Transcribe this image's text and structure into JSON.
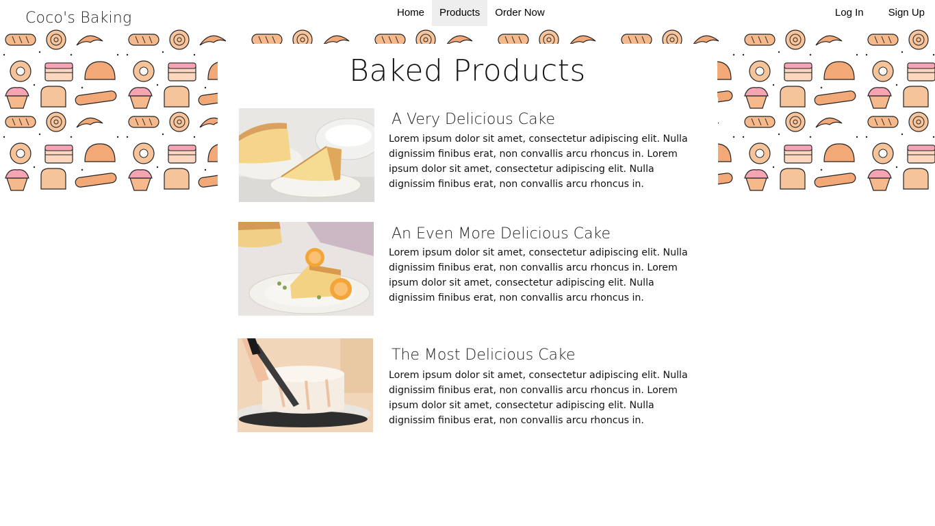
{
  "brand": {
    "name": "Coco's Baking"
  },
  "nav": {
    "links": [
      {
        "label": "Home"
      },
      {
        "label": "Products"
      },
      {
        "label": "Order Now"
      }
    ],
    "active": "Products",
    "auth": [
      {
        "label": "Log In"
      },
      {
        "label": "Sign Up"
      }
    ]
  },
  "page": {
    "title": "Baked Products"
  },
  "products": [
    {
      "title": "A Very Delicious Cake",
      "description": "Lorem ipsum dolor sit amet, consectetur adipiscing elit. Nulla dignissim finibus erat, non convallis arcu rhoncus in. Lorem ipsum dolor sit amet, consectetur adipiscing elit. Nulla dignissim finibus erat, non convallis arcu rhoncus in.",
      "image": "sponge-cake-slice-photo"
    },
    {
      "title": "An Even More Delicious Cake",
      "description": "Lorem ipsum dolor sit amet, consectetur adipiscing elit. Nulla dignissim finibus erat, non convallis arcu rhoncus in. Lorem ipsum dolor sit amet, consectetur adipiscing elit. Nulla dignissim finibus erat, non convallis arcu rhoncus in.",
      "image": "peach-cake-slice-photo"
    },
    {
      "title": "The Most Delicious Cake",
      "description": "Lorem ipsum dolor sit amet, consectetur adipiscing elit. Nulla dignissim finibus erat, non convallis arcu rhoncus in. Lorem ipsum dolor sit amet, consectetur adipiscing elit. Nulla dignissim finibus erat, non convallis arcu rhoncus in.",
      "image": "frosting-cake-photo"
    }
  ],
  "colors": {
    "pattern_orange": "#f3a878",
    "pattern_pink": "#f6a4b4",
    "nav_active_bg": "#eeeeee"
  }
}
